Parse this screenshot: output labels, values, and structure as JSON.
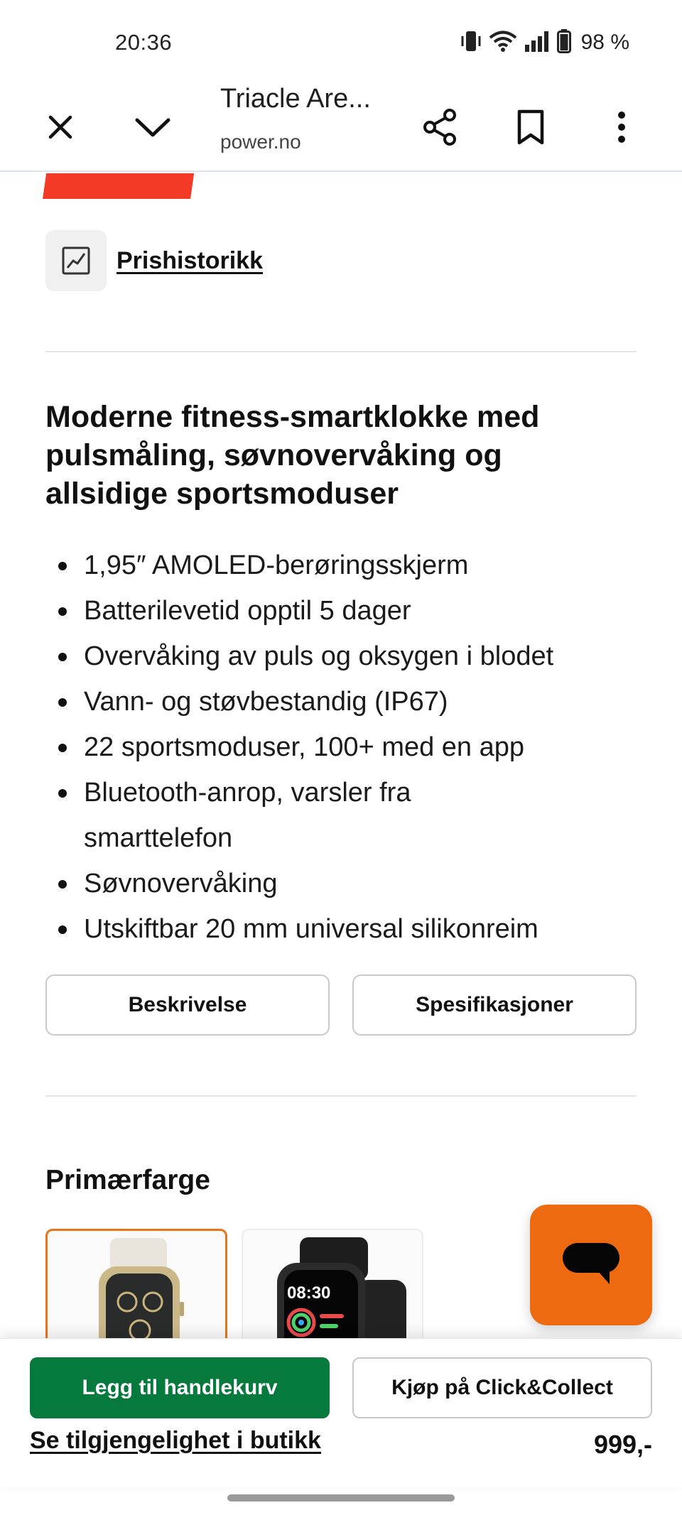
{
  "status_bar": {
    "time": "20:36",
    "battery": "98 %",
    "icons": [
      "vibrate-icon",
      "wifi-icon",
      "signal-icon",
      "battery-icon"
    ]
  },
  "browser": {
    "title": "Triacle Are...",
    "domain": "power.no",
    "icons": [
      "close-icon",
      "chevron-down-icon",
      "share-icon",
      "bookmark-icon",
      "more-vert-icon"
    ]
  },
  "product": {
    "price_history_label": "Prishistorikk",
    "headline": "Moderne fitness-smartklokke med pulsmåling, søvnovervåking og allsidige sportsmoduser",
    "features": [
      "1,95″ AMOLED-berøringsskjerm",
      "Batterilevetid opptil 5 dager",
      "Overvåking av puls og oksygen i blodet",
      "Vann- og støvbestandig (IP67)",
      "22 sportsmoduser, 100+ med en app",
      "Bluetooth-anrop, varsler fra smarttelefon",
      "Søvnovervåking",
      "Utskiftbar 20 mm universal silikonreim"
    ],
    "description_button": "Beskrivelse",
    "specs_button": "Spesifikasjoner",
    "color_section_title": "Primærfarge",
    "watch2_time": "08:30"
  },
  "bottom": {
    "add_to_cart": "Legg til handlekurv",
    "click_collect": "Kjøp på Click&Collect",
    "store_availability": "Se tilgjengelighet i butikk",
    "price": "999,-"
  },
  "colors": {
    "brand_orange": "#ee6a10",
    "cart_green": "#067a3d",
    "price_red": "#f23a27"
  }
}
